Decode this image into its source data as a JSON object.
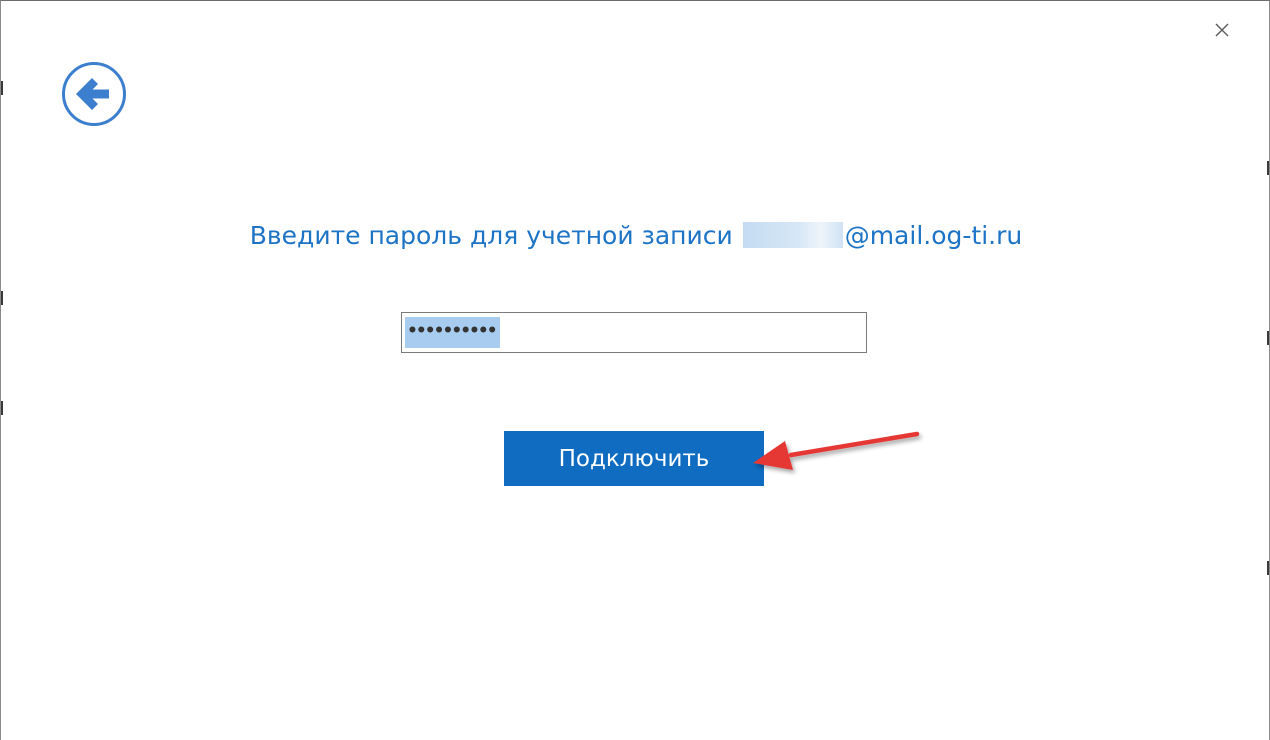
{
  "dialog": {
    "close_icon": "close-icon",
    "back_icon": "back-arrow-icon",
    "prompt_text": "Введите пароль для учетной записи",
    "prompt_domain": "@mail.og-ti.ru",
    "password_value": "••••••••••",
    "connect_label": "Подключить"
  },
  "colors": {
    "accent": "#0f6cc1",
    "prompt_text": "#1d74c6",
    "selection": "#a8ccef",
    "annotation_arrow": "#e53935"
  }
}
